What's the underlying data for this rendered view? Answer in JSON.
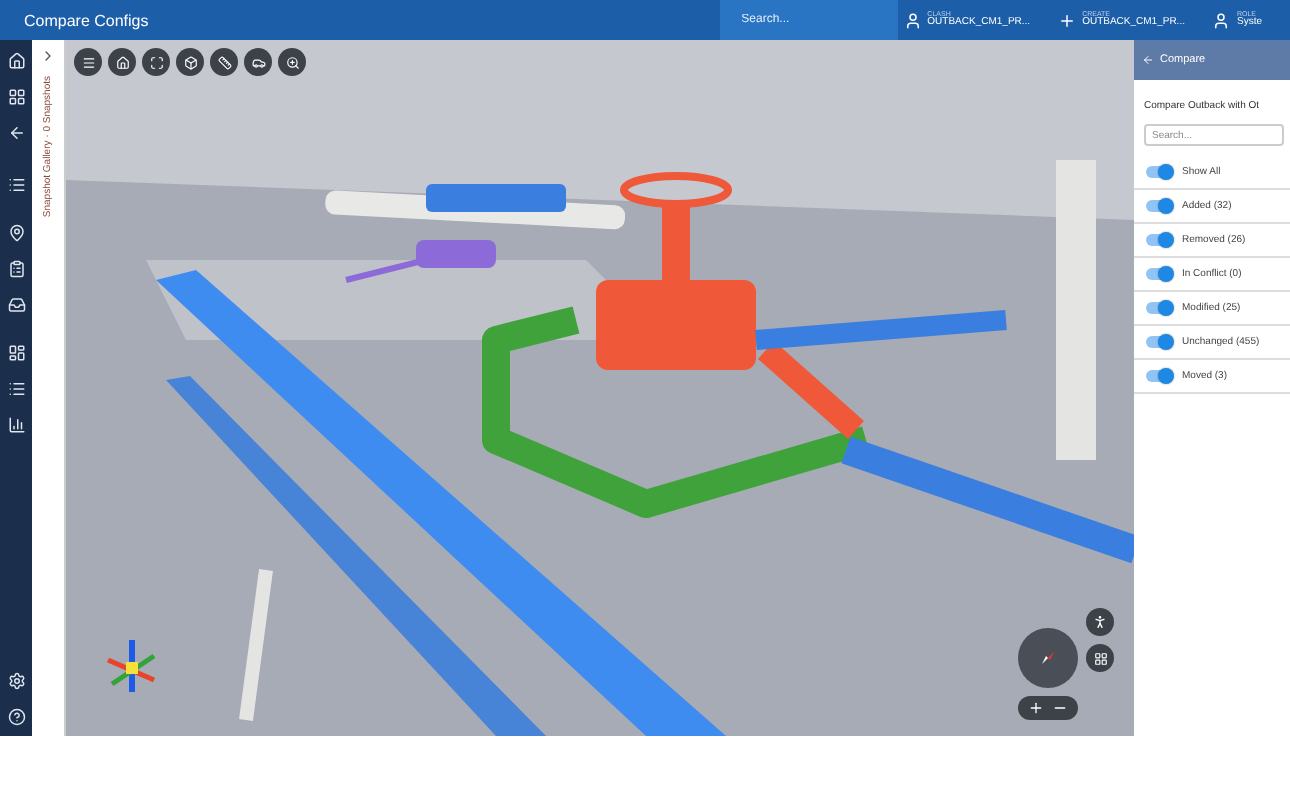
{
  "header": {
    "title": "Compare Configs",
    "search": {
      "placeholder": "Search..."
    },
    "items": [
      {
        "kind": "user",
        "label": "CLASH",
        "value": "OUTBACK_CM1_PR..."
      },
      {
        "kind": "create",
        "label": "CREATE",
        "value": "OUTBACK_CM1_PR..."
      },
      {
        "kind": "user",
        "label": "ROLE",
        "value": "Syste"
      }
    ]
  },
  "gallery": {
    "label": "Snapshot Gallery · 0 Snapshots"
  },
  "panel": {
    "title": "Compare",
    "subtitle": "Compare Outback with Ot",
    "search": {
      "placeholder": "Search..."
    },
    "show_all": {
      "label": "Show All",
      "on": true
    },
    "filters": [
      {
        "label": "Added (32)",
        "on": true
      },
      {
        "label": "Removed (26)",
        "on": true
      },
      {
        "label": "In Conflict (0)",
        "on": true
      },
      {
        "label": "Modified (25)",
        "on": true
      },
      {
        "label": "Unchanged (455)",
        "on": true
      },
      {
        "label": "Moved (3)",
        "on": true
      }
    ]
  }
}
